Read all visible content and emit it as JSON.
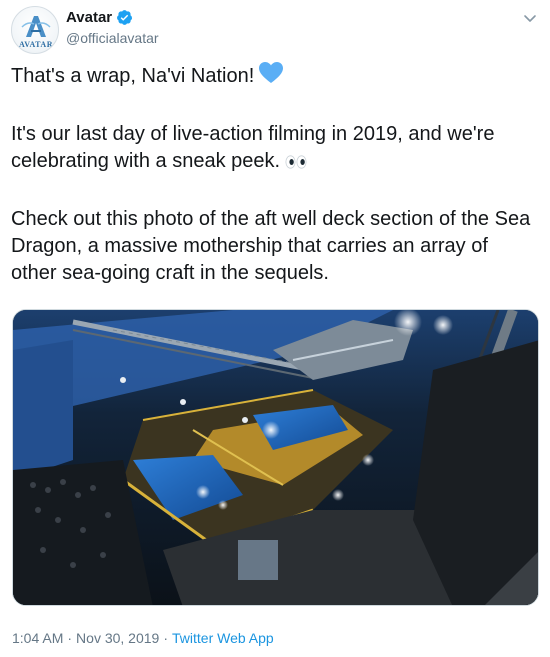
{
  "author": {
    "display_name": "Avatar",
    "handle": "@officialavatar",
    "avatar_logo_text": "AVATAR",
    "verified": true
  },
  "icons": {
    "verified": "verified-badge-icon",
    "menu": "chevron-down-icon",
    "heart": "blue-heart-emoji",
    "eyes": "eyes-emoji"
  },
  "tweet": {
    "paragraph_1": "That's a wrap, Na'vi Nation!",
    "paragraph_2": "It's our last day of live-action filming in 2019, and we're celebrating with a sneak peek.",
    "paragraph_3": "Check out this photo of the aft well deck section of the Sea Dragon, a massive mothership that carries an array of other sea-going craft in the sequels."
  },
  "meta": {
    "time": "1:04 AM",
    "date": "Nov 30, 2019",
    "source": "Twitter Web App",
    "separator": "·"
  },
  "colors": {
    "link": "#1b95e0",
    "secondary_text": "#657786",
    "primary_text": "#14171a",
    "verified": "#1da1f2",
    "heart": "#5aaef5"
  }
}
